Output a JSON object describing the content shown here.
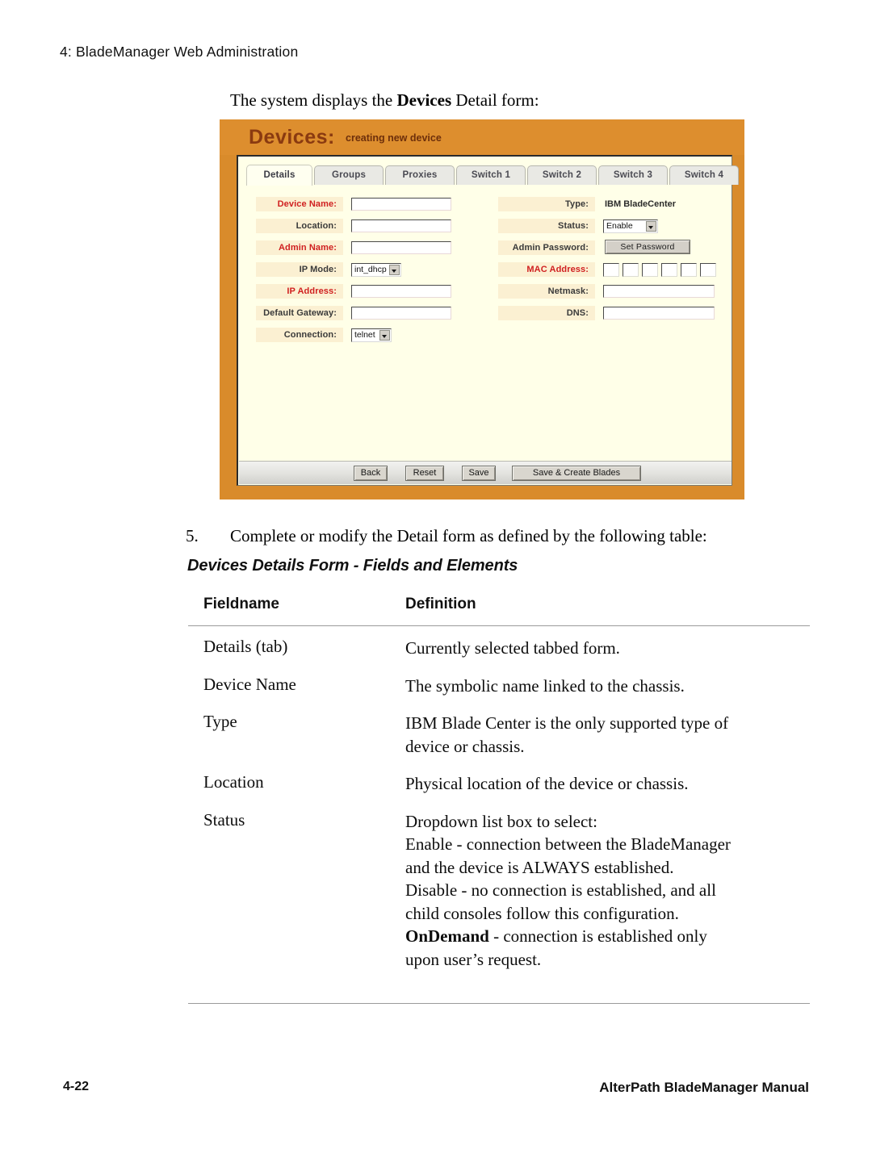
{
  "page": {
    "running_head": "4: BladeManager Web Administration",
    "intro_before": "The system displays the ",
    "intro_bold": "Devices",
    "intro_after": " Detail form:",
    "footer_left": "4-22",
    "footer_right": "AlterPath BladeManager Manual"
  },
  "step": {
    "number": "5.",
    "text": "Complete or modify the Detail form as defined by the following table:"
  },
  "screenshot": {
    "title": "Devices:",
    "subtitle": "creating new device",
    "accent_orange": "#dd8e2e",
    "title_brown": "#8a3a10",
    "panel_bg": "#ffffe8",
    "label_bg": "#fbf0d2",
    "required_color": "#d02020",
    "tabs": [
      {
        "label": "Details",
        "active": true
      },
      {
        "label": "Groups",
        "active": false
      },
      {
        "label": "Proxies",
        "active": false
      },
      {
        "label": "Switch 1",
        "active": false
      },
      {
        "label": "Switch 2",
        "active": false
      },
      {
        "label": "Switch 3",
        "active": false
      },
      {
        "label": "Switch 4",
        "active": false
      }
    ],
    "left_fields": [
      {
        "label": "Device Name:",
        "required": true,
        "control": "text",
        "value": ""
      },
      {
        "label": "Location:",
        "required": false,
        "control": "text",
        "value": ""
      },
      {
        "label": "Admin Name:",
        "required": true,
        "control": "text",
        "value": ""
      },
      {
        "label": "IP Mode:",
        "required": false,
        "control": "select",
        "value": "int_dhcp"
      },
      {
        "label": "IP Address:",
        "required": true,
        "control": "text",
        "value": ""
      },
      {
        "label": "Default Gateway:",
        "required": false,
        "control": "text",
        "value": ""
      },
      {
        "label": "Connection:",
        "required": false,
        "control": "select",
        "value": "telnet"
      }
    ],
    "right_fields": [
      {
        "label": "Type:",
        "required": false,
        "control": "static",
        "value": "IBM BladeCenter"
      },
      {
        "label": "Status:",
        "required": false,
        "control": "select",
        "value": "Enable"
      },
      {
        "label": "Admin Password:",
        "required": false,
        "control": "button",
        "value": "Set Password"
      },
      {
        "label": "MAC Address:",
        "required": true,
        "control": "mac",
        "value": "",
        "boxes": 6
      },
      {
        "label": "Netmask:",
        "required": false,
        "control": "text",
        "value": ""
      },
      {
        "label": "DNS:",
        "required": false,
        "control": "text",
        "value": ""
      }
    ],
    "buttons": [
      {
        "label": "Back"
      },
      {
        "label": "Reset"
      },
      {
        "label": "Save"
      },
      {
        "label": "Save & Create Blades"
      }
    ]
  },
  "table": {
    "caption": "Devices Details Form - Fields and Elements",
    "headers": {
      "fieldname": "Fieldname",
      "definition": "Definition"
    },
    "rows": [
      {
        "fieldname": "Details (tab)",
        "definition_lines": [
          [
            {
              "t": "Currently selected tabbed form.",
              "b": false
            }
          ]
        ]
      },
      {
        "fieldname": "Device Name",
        "definition_lines": [
          [
            {
              "t": "The symbolic name linked to the chassis.",
              "b": false
            }
          ]
        ]
      },
      {
        "fieldname": "Type",
        "definition_lines": [
          [
            {
              "t": "IBM Blade Center is the only supported type of",
              "b": false
            }
          ],
          [
            {
              "t": "device or chassis.",
              "b": false
            }
          ]
        ]
      },
      {
        "fieldname": "Location",
        "definition_lines": [
          [
            {
              "t": "Physical location of the device or chassis.",
              "b": false
            }
          ]
        ]
      },
      {
        "fieldname": "Status",
        "definition_lines": [
          [
            {
              "t": "Dropdown list box to select:",
              "b": false
            }
          ],
          [
            {
              "t": "Enable - connection between the BladeManager",
              "b": false
            }
          ],
          [
            {
              "t": "and the device is ALWAYS established.",
              "b": false
            }
          ],
          [
            {
              "t": "Disable - no connection is established, and all",
              "b": false
            }
          ],
          [
            {
              "t": "child consoles follow this configuration.",
              "b": false
            }
          ],
          [
            {
              "t": "OnDemand",
              "b": true
            },
            {
              "t": " - connection is established only",
              "b": false
            }
          ],
          [
            {
              "t": "upon user’s request.",
              "b": false
            }
          ]
        ]
      }
    ]
  }
}
